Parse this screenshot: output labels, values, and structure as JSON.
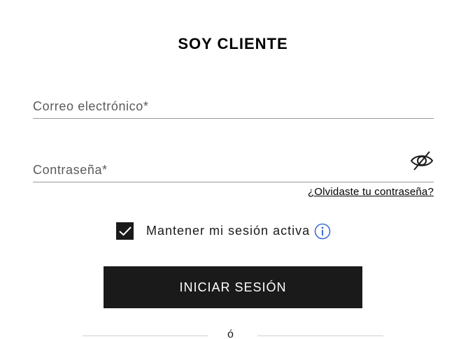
{
  "title": "SOY CLIENTE",
  "email": {
    "placeholder": "Correo electrónico*",
    "value": ""
  },
  "password": {
    "placeholder": "Contraseña*",
    "value": "",
    "toggle_icon": "eye-slash-icon"
  },
  "forgot_link": "¿Olvidaste tu contraseña?",
  "remember": {
    "label": "Mantener mi sesión activa",
    "checked": true,
    "info_icon": "info-icon"
  },
  "login_button": "INICIAR SESIÓN",
  "divider_text": "ó",
  "colors": {
    "button_bg": "#1a1a1a",
    "info_blue": "#3b6fd6",
    "line": "#9a9a9a"
  }
}
